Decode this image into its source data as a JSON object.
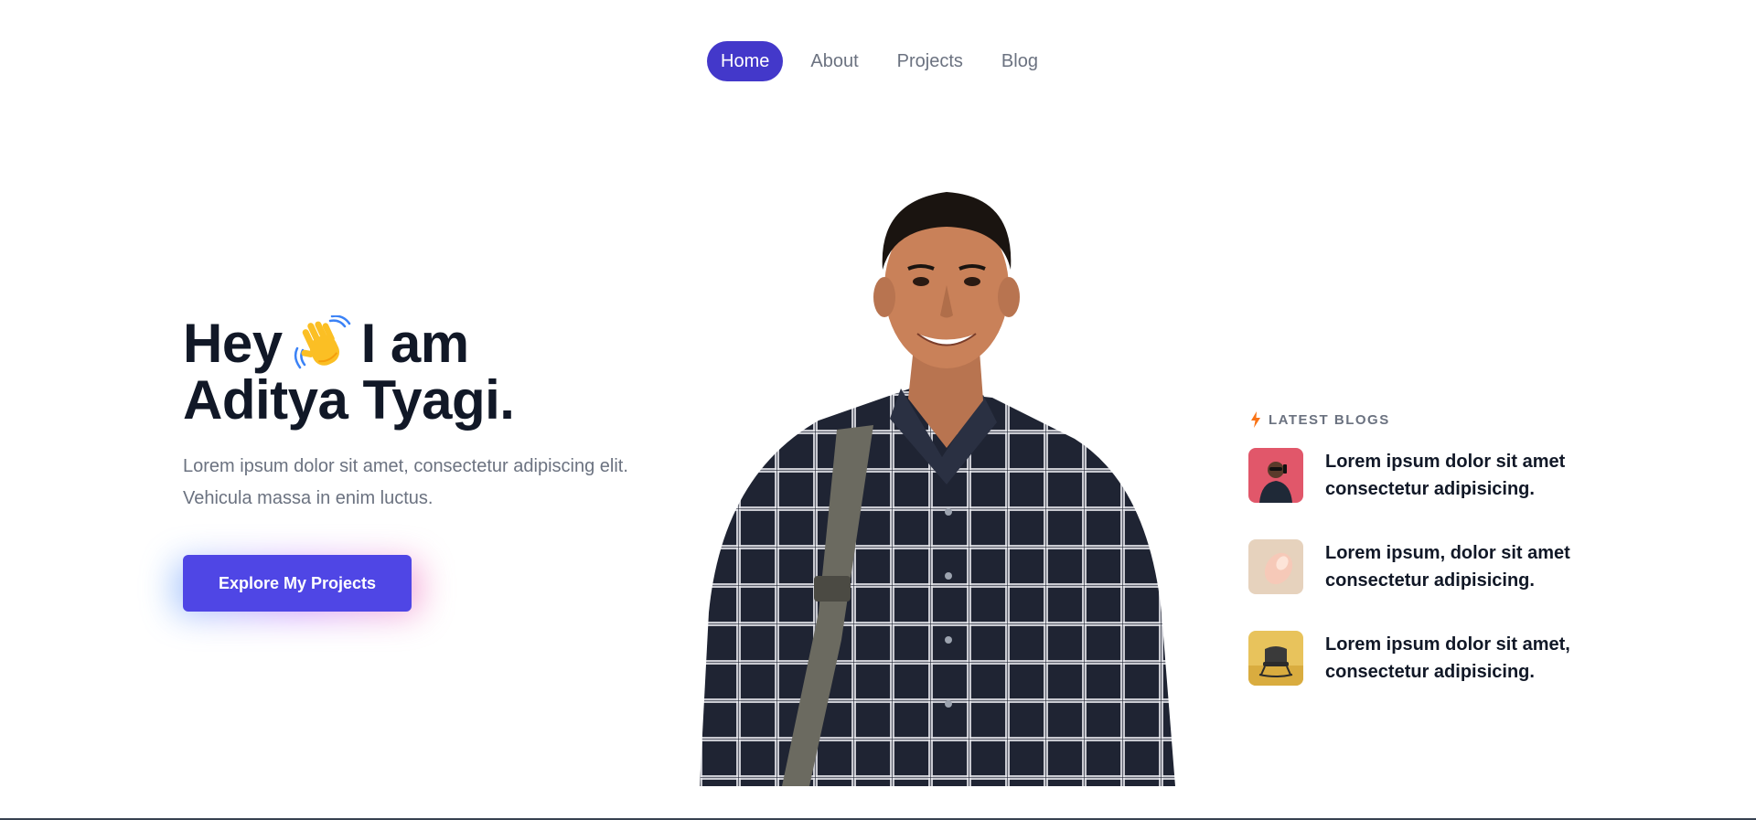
{
  "nav": {
    "items": [
      {
        "label": "Home",
        "active": true
      },
      {
        "label": "About",
        "active": false
      },
      {
        "label": "Projects",
        "active": false
      },
      {
        "label": "Blog",
        "active": false
      }
    ]
  },
  "hero": {
    "title_line1_before": "Hey",
    "title_line1_after": "I am",
    "title_line2": "Aditya Tyagi.",
    "wave_icon": "waving-hand-icon",
    "description": "Lorem ipsum dolor sit amet, consectetur adipiscing elit. Vehicula massa in enim luctus.",
    "cta_label": "Explore My Projects"
  },
  "blogs": {
    "heading": "LATEST BLOGS",
    "heading_icon": "lightning-bolt-icon",
    "items": [
      {
        "title": "Lorem ipsum dolor sit amet consectetur adipisicing."
      },
      {
        "title": "Lorem ipsum, dolor sit amet consectetur adipisicing."
      },
      {
        "title": "Lorem ipsum dolor sit amet, consectetur adipisicing."
      }
    ]
  },
  "colors": {
    "accent": "#4338ca",
    "cta": "#4f46e5",
    "heading": "#111827",
    "muted": "#6b7280",
    "bolt": "#f97316"
  }
}
